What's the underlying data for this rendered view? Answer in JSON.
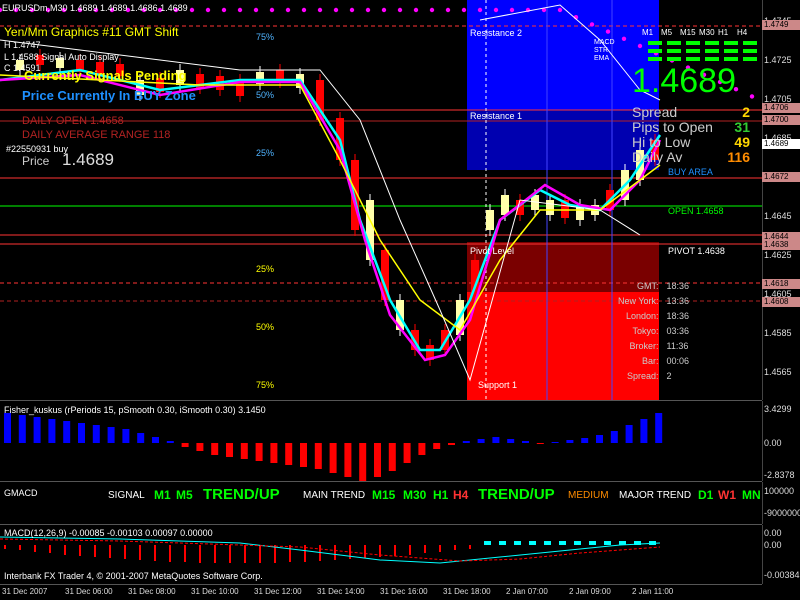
{
  "window": {
    "title": "EURUSDm,M30  1.4689 1.4689 1.4686 1.4689"
  },
  "main_overlay": {
    "line1": "Yen/Mm Graphics #11 GMT Shift",
    "h_line": "H 1.4747",
    "l_line": "L 1.4588  Signal Auto Display",
    "c_line": "C 1.4591",
    "signals_pending": "Currently Signals Pending",
    "price_currently": "Price Currently In BUY Zone",
    "daily_open": "DAILY OPEN     1.4658",
    "daily_avg_range": "DAILY AVERAGE RANGE  118",
    "ticket": "#22550931 buy",
    "price_label": "Price",
    "price_value": "1.4689"
  },
  "levels": {
    "resistance2": "Resistance 2",
    "resistance1": "Resistance 1",
    "pivot_level": "Pivot Level",
    "support1": "Support 1",
    "open_label": "OPEN 1.4658",
    "pivot_label": "PIVOT 1.4638",
    "buy_area": "BUY AREA",
    "pct_75_top": "75%",
    "pct_50_top": "50%",
    "pct_25_top": "25%",
    "pct_25_bot": "25%",
    "pct_50_bot": "50%",
    "pct_75_bot": "75%"
  },
  "signal_panel": {
    "timeframes": [
      "M1",
      "M5",
      "M15",
      "M30",
      "H1",
      "H4"
    ],
    "rows": [
      "MACD",
      "STR",
      "EMA"
    ],
    "price": "1.4689",
    "stats": [
      {
        "label": "Spread",
        "value": "2",
        "color": "#ffd700"
      },
      {
        "label": "Pips to Open",
        "value": "31",
        "color": "#32cd32"
      },
      {
        "label": "Hi to Low",
        "value": "49",
        "color": "#ffd700"
      },
      {
        "label": "Daily Av",
        "value": "116",
        "color": "#ff8c00"
      }
    ]
  },
  "time_table": [
    {
      "label": "GMT:",
      "value": "18:36"
    },
    {
      "label": "New York:",
      "value": "13:36"
    },
    {
      "label": "London:",
      "value": "18:36"
    },
    {
      "label": "Tokyo:",
      "value": "03:36"
    },
    {
      "label": "Broker:",
      "value": "11:36"
    },
    {
      "label": "Bar:",
      "value": "00:06"
    },
    {
      "label": "Spread:",
      "value": "2"
    }
  ],
  "price_axis": {
    "ticks": [
      "1.4745",
      "1.4725",
      "1.4705",
      "1.4685",
      "1.4665",
      "1.4645",
      "1.4625",
      "1.4605",
      "1.4585",
      "1.4565"
    ],
    "boxes": [
      "1.4749",
      "1.4706",
      "1.4700",
      "1.4689",
      "1.4672",
      "1.4644",
      "1.4638",
      "1.4618",
      "1.4608"
    ]
  },
  "fisher": {
    "title": "Fisher_kuskus  (rPeriods 15, pSmooth 0.30, iSmooth 0.30)  3.1450",
    "axis_top": "3.4299",
    "axis_mid": "0.00",
    "axis_bot": "-2.8378"
  },
  "gmacd": {
    "title": "GMACD",
    "signal": "SIGNAL",
    "sig_tf": [
      "M1",
      "M5"
    ],
    "trend1": "TREND/UP",
    "main_trend": "MAIN TREND",
    "main_tf": [
      "M15",
      "M30",
      "H1",
      "H4"
    ],
    "trend2": "TREND/UP",
    "medium": "MEDIUM",
    "major_trend": "MAJOR TREND",
    "major_tf": [
      "D1",
      "W1",
      "MN"
    ],
    "axis_top": "100000",
    "axis_bot": "-9000000"
  },
  "macd": {
    "title": "MACD(12,26,9) -0.00085 -0.00103 0.00097 0.00000",
    "axis_top": "0.00",
    "axis_mid": "0.00",
    "axis_bot": "-0.00384",
    "copyright": "Interbank FX Trader 4, © 2001-2007 MetaQuotes Software Corp."
  },
  "time_axis": [
    "31 Dec 2007",
    "31 Dec 06:00",
    "31 Dec 08:00",
    "31 Dec 10:00",
    "31 Dec 12:00",
    "31 Dec 14:00",
    "31 Dec 16:00",
    "31 Dec 18:00",
    "2 Jan 07:00",
    "2 Jan 09:00",
    "2 Jan 11:00"
  ],
  "colors": {
    "bull": "#ffffaa",
    "bear": "#ff0000",
    "cyan": "#00ffff",
    "magenta": "#ff00ff",
    "yellow": "#ffff00",
    "blue": "#0000ff",
    "green": "#00ff00"
  }
}
